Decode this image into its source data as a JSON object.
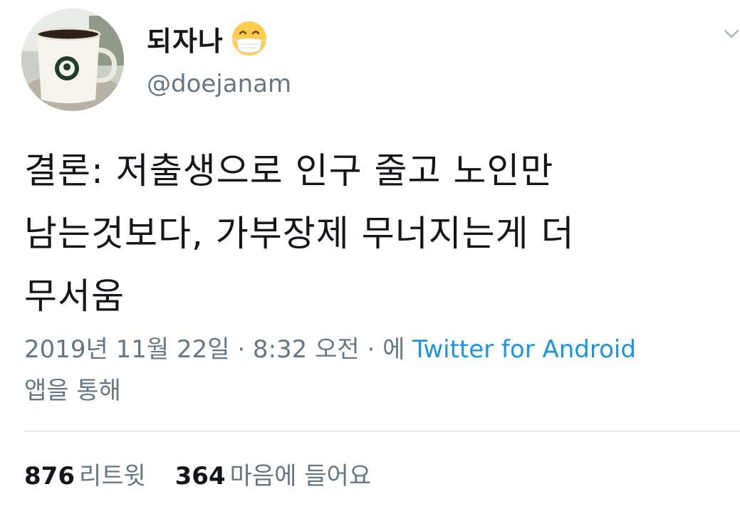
{
  "author": {
    "display_name": "되자나",
    "username": "@doejanam",
    "emoji_icon": "face-with-medical-mask-emoji"
  },
  "tweet": {
    "text_lines": [
      "결론: 저출생으로 인구 줄고 노인만",
      "남는것보다, 가부장제 무너지는게 더",
      "무서움"
    ]
  },
  "meta": {
    "timestamp": "2019년 11월 22일 · 8:32 오전 · 에 ",
    "source": "Twitter for Android",
    "suffix": "앱을 통해"
  },
  "stats": {
    "retweets_count": "876",
    "retweets_label": "리트윗",
    "likes_count": "364",
    "likes_label": "마음에 들어요"
  },
  "colors": {
    "primary_text": "#14171a",
    "secondary_text": "#657786",
    "link": "#1b95e0",
    "divider": "#e6ecf0"
  }
}
